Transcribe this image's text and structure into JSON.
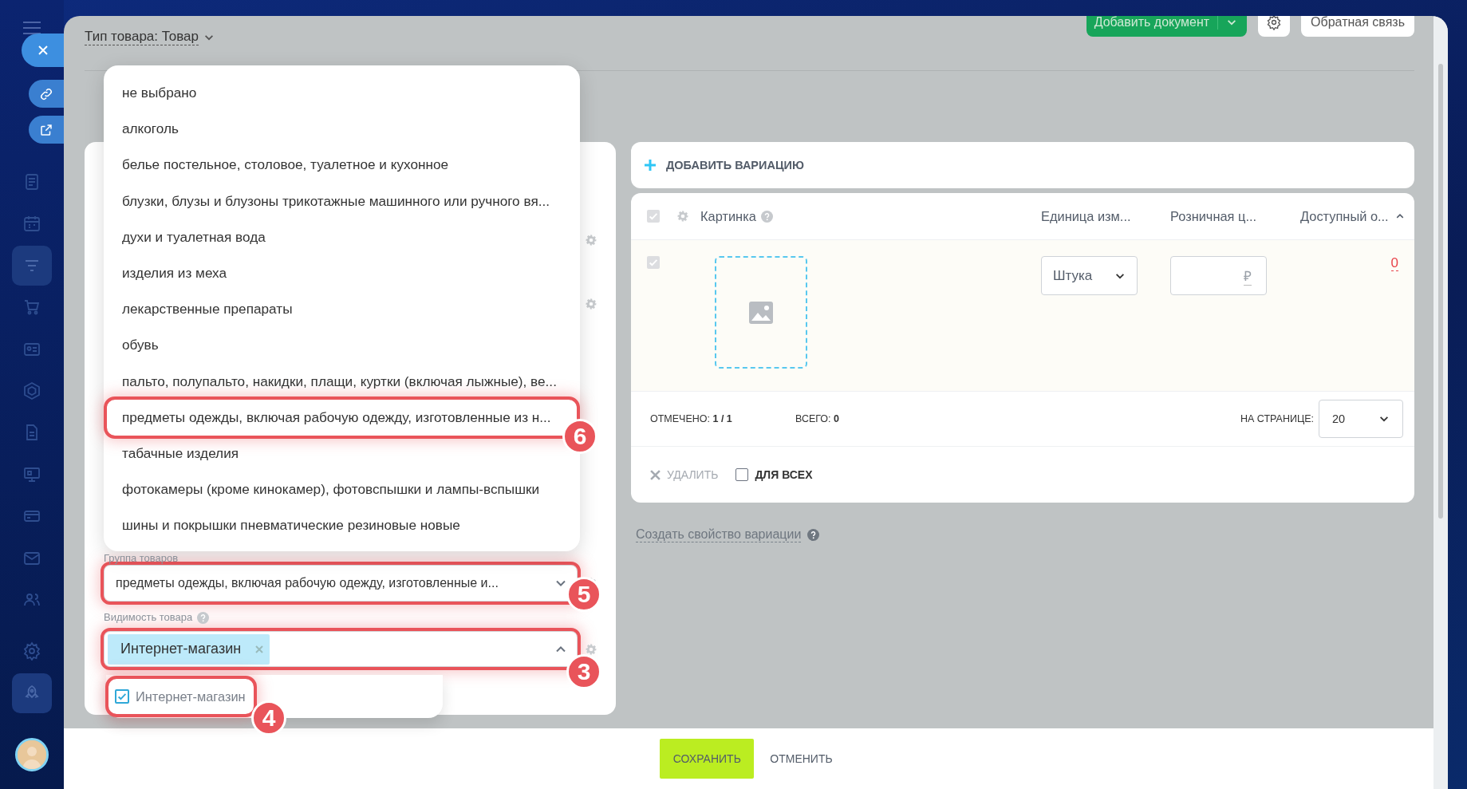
{
  "sidebar": {
    "items": [
      {
        "selected": false
      },
      {
        "selected": false
      },
      {
        "selected": true
      },
      {
        "selected": false
      },
      {
        "selected": false
      },
      {
        "selected": false
      },
      {
        "selected": false
      },
      {
        "selected": false
      },
      {
        "selected": false
      },
      {
        "selected": false
      },
      {
        "selected": false
      },
      {
        "selected": false
      },
      {
        "selected": true
      }
    ]
  },
  "header": {
    "product_type": "Тип товара: Товар",
    "add_document": "Добавить документ",
    "feedback": "Обратная связь"
  },
  "dropdown": {
    "options": [
      {
        "label": "не выбрано",
        "highlighted": false
      },
      {
        "label": "алкоголь",
        "highlighted": false
      },
      {
        "label": "белье постельное, столовое, туалетное и кухонное",
        "highlighted": false
      },
      {
        "label": "блузки, блузы и блузоны трикотажные машинного или ручного вя...",
        "highlighted": false
      },
      {
        "label": "духи и туалетная вода",
        "highlighted": false
      },
      {
        "label": "изделия из меха",
        "highlighted": false
      },
      {
        "label": "лекарственные препараты",
        "highlighted": false
      },
      {
        "label": "обувь",
        "highlighted": false
      },
      {
        "label": "пальто, полупальто, накидки, плащи, куртки (включая лыжные), ве...",
        "highlighted": false
      },
      {
        "label": "предметы одежды, включая рабочую одежду, изготовленные из н...",
        "highlighted": true,
        "badge": "6"
      },
      {
        "label": "табачные изделия",
        "highlighted": false
      },
      {
        "label": "фотокамеры (кроме кинокамер), фотовспышки и лампы-вспышки",
        "highlighted": false
      },
      {
        "label": "шины и покрышки пневматические резиновые новые",
        "highlighted": false
      }
    ]
  },
  "form": {
    "group_label": "Группа товаров",
    "group": {
      "value": "предметы одежды, включая рабочую одежду, изготовленные и...",
      "highlighted": true,
      "badge": "5"
    },
    "visibility_label": "Видимость товара",
    "visibility": {
      "tags": [
        "Интернет-магазин"
      ],
      "expanded": true,
      "highlighted": true,
      "badge": "3"
    },
    "visibility_options": [
      {
        "label": "Интернет-магазин",
        "checked": true,
        "highlighted": true,
        "badge": "4"
      }
    ]
  },
  "variations": {
    "add_button": "ДОБАВИТЬ ВАРИАЦИЮ",
    "header_checked": true,
    "columns": [
      "Картинка",
      "Единица изм...",
      "Розничная ц...",
      "Доступный о..."
    ],
    "rows": [
      {
        "checked": true,
        "unit": "Штука",
        "currency": "₽",
        "available": "0"
      }
    ],
    "marked": "ОТМЕЧЕНО: **1 / 1**",
    "total": "ВСЕГО: **0**",
    "per_page_label": "НА СТРАНИЦЕ:",
    "per_page": "20",
    "delete": "УДАЛИТЬ",
    "for_all": {
      "label": "ДЛЯ ВСЕХ",
      "checked": false
    }
  },
  "create_property_link": "Создать свойство вариации",
  "footer": {
    "save": "СОХРАНИТЬ",
    "cancel": "ОТМЕНИТЬ"
  }
}
